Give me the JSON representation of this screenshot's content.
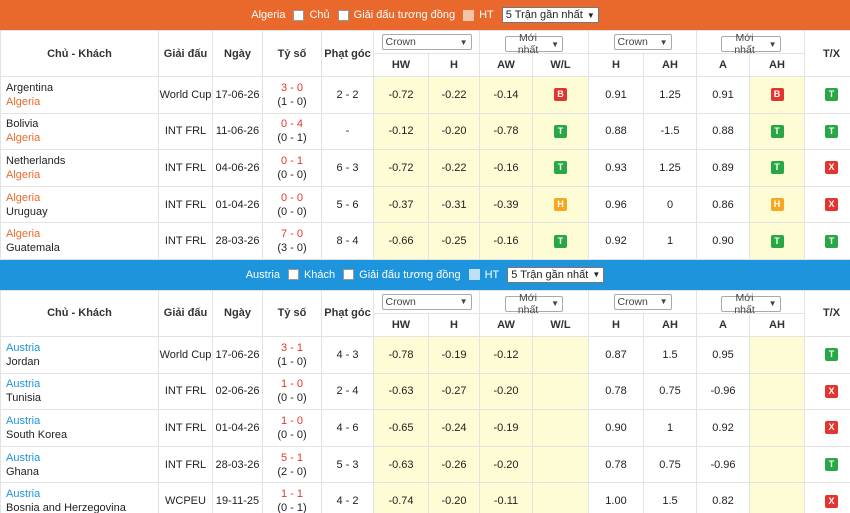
{
  "section1": {
    "team_label": "Algeria",
    "opt_home": "Chủ",
    "opt_same_league": "Giải đấu tương đồng",
    "opt_ht": "HT",
    "recent_select": "5 Trận gần nhất"
  },
  "section2": {
    "team_label": "Austria",
    "opt_home": "Khách",
    "opt_same_league": "Giải đấu tương đồng",
    "opt_ht": "HT",
    "recent_select": "5 Trận gần nhất"
  },
  "headers": {
    "teams": "Chủ - Khách",
    "league": "Giải đấu",
    "date": "Ngày",
    "score": "Tỷ số",
    "corners": "Phạt góc",
    "bookmaker_select": "Crown",
    "odds_select": "Mới nhất",
    "hw": "HW",
    "h": "H",
    "aw": "AW",
    "wl": "W/L",
    "h2": "H",
    "ah": "AH",
    "a": "A",
    "ah2": "AH",
    "tx": "T/X"
  },
  "colors": {
    "orange": "#e8692b",
    "blue": "#1e94dc",
    "win": "#27a844",
    "loss": "#e3342f",
    "draw": "#f5a623"
  },
  "rows1": [
    {
      "home": "Argentina",
      "away": "Algeria",
      "home_hl": false,
      "league": "World Cup",
      "date": "17-06-26",
      "ft": "3 - 0",
      "ht": "(1 - 0)",
      "corners": "2 - 2",
      "hw": "-0.72",
      "h": "-0.22",
      "aw": "-0.14",
      "wl": "B",
      "oh": "0.91",
      "ah": "1.25",
      "oa": "0.91",
      "ah_res": "B",
      "tx": "T"
    },
    {
      "home": "Bolivia",
      "away": "Algeria",
      "home_hl": false,
      "league": "INT FRL",
      "date": "11-06-26",
      "ft": "0 - 4",
      "ht": "(0 - 1)",
      "corners": "-",
      "hw": "-0.12",
      "h": "-0.20",
      "aw": "-0.78",
      "wl": "T",
      "oh": "0.88",
      "ah": "-1.5",
      "oa": "0.88",
      "ah_res": "T",
      "tx": "T"
    },
    {
      "home": "Netherlands",
      "away": "Algeria",
      "home_hl": false,
      "league": "INT FRL",
      "date": "04-06-26",
      "ft": "0 - 1",
      "ht": "(0 - 0)",
      "corners": "6 - 3",
      "hw": "-0.72",
      "h": "-0.22",
      "aw": "-0.16",
      "wl": "T",
      "oh": "0.93",
      "ah": "1.25",
      "oa": "0.89",
      "ah_res": "T",
      "tx": "X"
    },
    {
      "home": "Algeria",
      "away": "Uruguay",
      "home_hl": true,
      "league": "INT FRL",
      "date": "01-04-26",
      "ft": "0 - 0",
      "ht": "(0 - 0)",
      "corners": "5 - 6",
      "hw": "-0.37",
      "h": "-0.31",
      "aw": "-0.39",
      "wl": "H",
      "oh": "0.96",
      "ah": "0",
      "oa": "0.86",
      "ah_res": "H",
      "tx": "X"
    },
    {
      "home": "Algeria",
      "away": "Guatemala",
      "home_hl": true,
      "league": "INT FRL",
      "date": "28-03-26",
      "ft": "7 - 0",
      "ht": "(3 - 0)",
      "corners": "8 - 4",
      "hw": "-0.66",
      "h": "-0.25",
      "aw": "-0.16",
      "wl": "T",
      "oh": "0.92",
      "ah": "1",
      "oa": "0.90",
      "ah_res": "T",
      "tx": "T"
    }
  ],
  "rows2": [
    {
      "home": "Austria",
      "away": "Jordan",
      "league": "World Cup",
      "date": "17-06-26",
      "ft": "3 - 1",
      "ht": "(1 - 0)",
      "corners": "4 - 3",
      "hw": "-0.78",
      "h": "-0.19",
      "aw": "-0.12",
      "oh": "0.87",
      "ah": "1.5",
      "oa": "0.95",
      "tx": "T"
    },
    {
      "home": "Austria",
      "away": "Tunisia",
      "league": "INT FRL",
      "date": "02-06-26",
      "ft": "1 - 0",
      "ht": "(0 - 0)",
      "corners": "2 - 4",
      "hw": "-0.63",
      "h": "-0.27",
      "aw": "-0.20",
      "oh": "0.78",
      "ah": "0.75",
      "oa": "-0.96",
      "tx": "X"
    },
    {
      "home": "Austria",
      "away": "South Korea",
      "league": "INT FRL",
      "date": "01-04-26",
      "ft": "1 - 0",
      "ht": "(0 - 0)",
      "corners": "4 - 6",
      "hw": "-0.65",
      "h": "-0.24",
      "aw": "-0.19",
      "oh": "0.90",
      "ah": "1",
      "oa": "0.92",
      "tx": "X"
    },
    {
      "home": "Austria",
      "away": "Ghana",
      "league": "INT FRL",
      "date": "28-03-26",
      "ft": "5 - 1",
      "ht": "(2 - 0)",
      "corners": "5 - 3",
      "hw": "-0.63",
      "h": "-0.26",
      "aw": "-0.20",
      "oh": "0.78",
      "ah": "0.75",
      "oa": "-0.96",
      "tx": "T"
    },
    {
      "home": "Austria",
      "away": "Bosnia and Herzegovina",
      "league": "WCPEU",
      "date": "19-11-25",
      "ft": "1 - 1",
      "ht": "(0 - 1)",
      "corners": "4 - 2",
      "hw": "-0.74",
      "h": "-0.20",
      "aw": "-0.11",
      "oh": "1.00",
      "ah": "1.5",
      "oa": "0.82",
      "tx": "X"
    }
  ]
}
